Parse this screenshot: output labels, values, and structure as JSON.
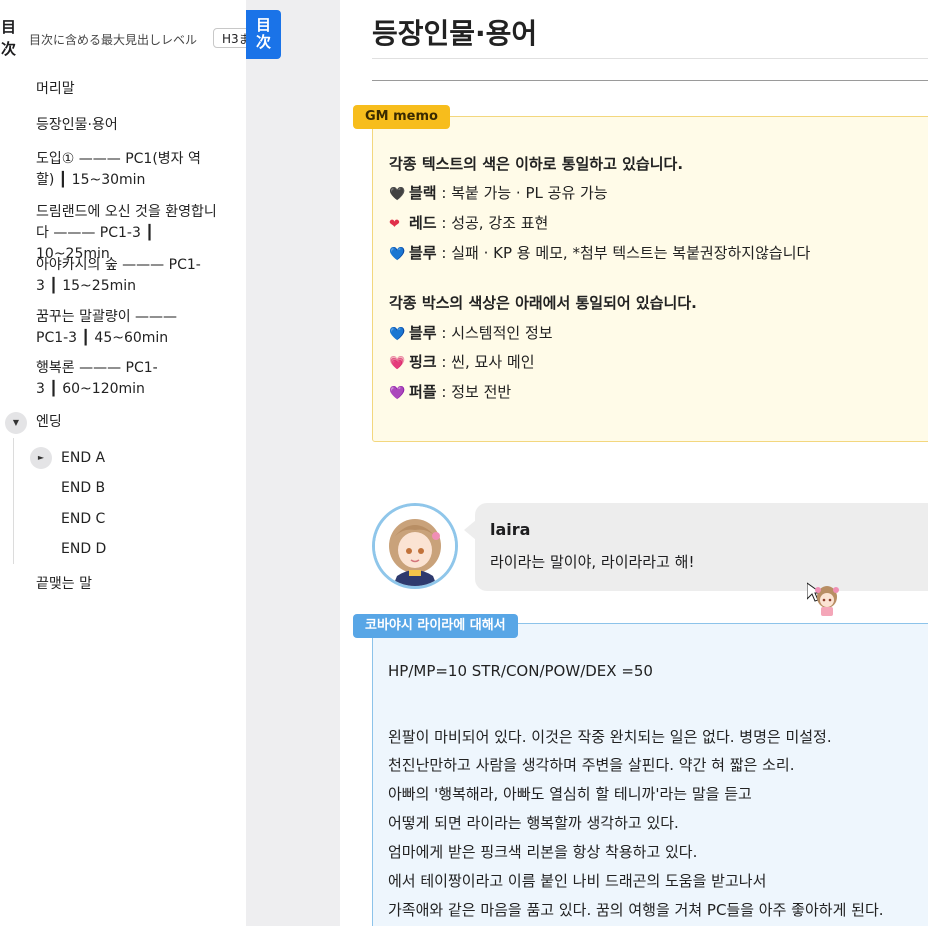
{
  "sidebar": {
    "toc_title": "目\n次",
    "level_label": "目次に含める最大見出しレベル",
    "level_select_value": "H3ま",
    "items": [
      {
        "label": "머리말"
      },
      {
        "label": "등장인물·용어"
      },
      {
        "label": "도입① ——— PC1(병자 역할) ┃ 15~30min"
      },
      {
        "label": "드림랜드에 오신 것을 환영합니다 ——— PC1-3 ┃ 10~25min"
      },
      {
        "label": "아야카시의 숲 ——— PC1-3 ┃ 15~25min"
      },
      {
        "label": "꿈꾸는 말괄량이 ——— PC1-3 ┃ 45~60min"
      },
      {
        "label": "행복론 ——— PC1-3 ┃ 60~120min"
      },
      {
        "label": "엔딩"
      },
      {
        "label": "끝맺는 말"
      }
    ],
    "sub_items": [
      {
        "label": "END A"
      },
      {
        "label": "END B"
      },
      {
        "label": "END C"
      },
      {
        "label": "END D"
      }
    ],
    "toggle_open_glyph": "▼",
    "toggle_closed_glyph": "►",
    "tab_label": "目\n次",
    "colors": {
      "tab": "#1a73e8"
    }
  },
  "main": {
    "title": "등장인물·용어",
    "memo": {
      "label": "GM memo",
      "heading1": "각종 텍스트의 색은 이하로 통일하고 있습니다.",
      "text_colors": [
        {
          "icon": "black-heart-icon",
          "glyph": "🖤",
          "color": "#222222",
          "name": "블랙",
          "desc": " : 복붙 가능 · PL 공유 가능"
        },
        {
          "icon": "red-heart-icon",
          "glyph": "❤",
          "color": "#e0304a",
          "name": "레드",
          "desc": " : 성공, 강조 표현"
        },
        {
          "icon": "blue-heart-icon",
          "glyph": "💙",
          "color": "#3d7fe0",
          "name": "블루",
          "desc": " : 실패 · KP 용 메모, *첨부 텍스트는 복붙권장하지않습니다"
        }
      ],
      "heading2": "각종 박스의 색상은 아래에서 통일되어 있습니다.",
      "box_colors": [
        {
          "icon": "blue-heart-icon",
          "glyph": "💙",
          "color": "#3d7fe0",
          "name": "블루",
          "desc": " : 시스템적인 정보"
        },
        {
          "icon": "pink-heart-icon",
          "glyph": "💗",
          "color": "#f05aa0",
          "name": "핑크",
          "desc": " : 씬, 묘사 메인"
        },
        {
          "icon": "purple-heart-icon",
          "glyph": "💜",
          "color": "#8a4fd6",
          "name": "퍼플",
          "desc": " : 정보 전반"
        }
      ]
    },
    "chat": {
      "speaker": "laira",
      "text": "라이라는 말이야, 라이라라고 해!"
    },
    "info": {
      "label": "코바야시 라이라에 대해서",
      "lines": [
        "HP/MP=10 STR/CON/POW/DEX =50",
        "",
        "왼팔이 마비되어 있다. 이것은 작중 완치되는 일은 없다. 병명은 미설정.",
        "천진난만하고 사람을 생각하며 주변을 살핀다. 약간 혀 짧은 소리.",
        "아빠의 '행복해라, 아빠도 열심히 할 테니까'라는 말을 듣고",
        "어떻게 되면 라이라는 행복할까 생각하고 있다.",
        "엄마에게 받은 핑크색 리본을 항상 착용하고 있다.",
        "에서 테이짱이라고 이름 붙인 나비 드래곤의 도움을 받고나서",
        "가족애와 같은 마음을 품고 있다. 꿈의 여행을 거쳐 PC들을 아주 좋아하게 된다."
      ]
    },
    "colors": {
      "memo_bg": "#fffbe8",
      "memo_label": "#f7bd1c",
      "info_bg": "#eef6fd",
      "info_label": "#58a6e6"
    }
  }
}
